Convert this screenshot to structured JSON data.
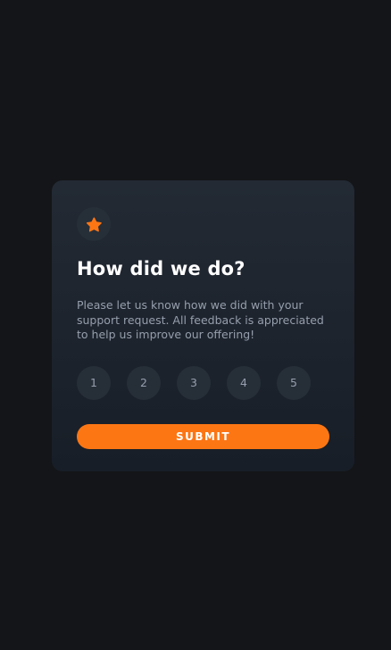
{
  "colors": {
    "background": "#131518",
    "accent": "#fc7614",
    "text_primary": "#ffffff",
    "text_secondary": "#969fad",
    "chip_bg": "#262e38"
  },
  "card": {
    "icon": "star-icon",
    "title": "How did we do?",
    "description": "Please let us know how we did with your support request. All feedback is appreciated to help us improve our offering!",
    "ratings": [
      "1",
      "2",
      "3",
      "4",
      "5"
    ],
    "submit_label": "SUBMIT"
  }
}
